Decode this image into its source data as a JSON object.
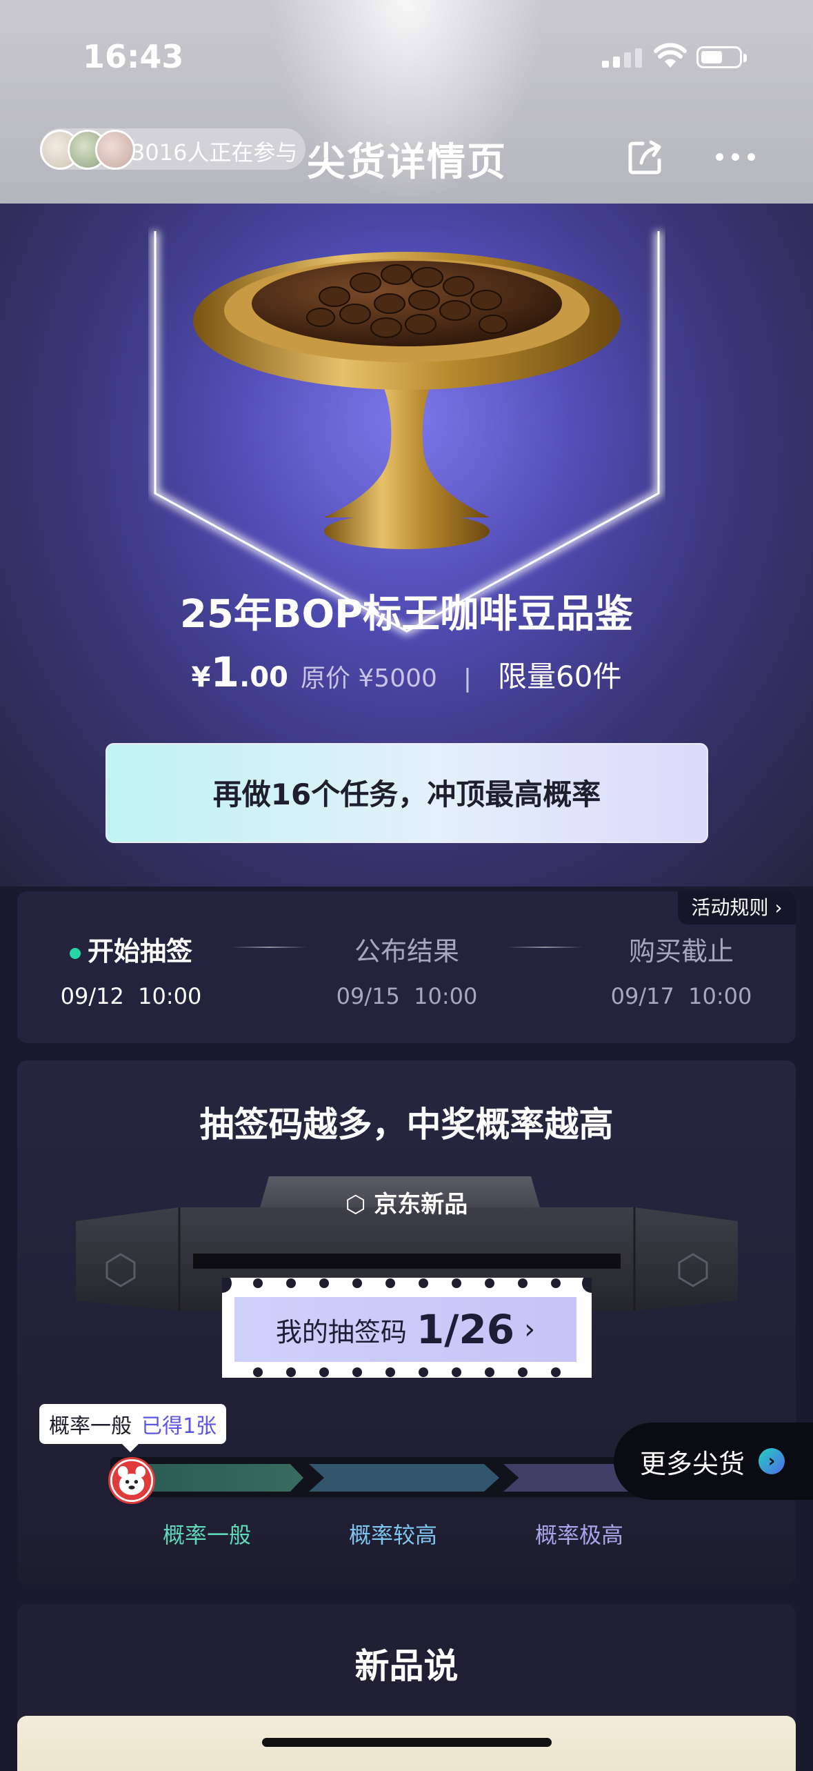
{
  "status_bar": {
    "time": "16:43"
  },
  "header": {
    "participants_text": "3016人正在参与",
    "title": "尖货详情页"
  },
  "product": {
    "title": "25年BOP标王咖啡豆品鉴",
    "price_symbol": "¥",
    "price_int": "1",
    "price_dec": ".00",
    "original_price": "原价 ¥5000",
    "separator": "|",
    "limit": "限量60件"
  },
  "task_button": {
    "label": "再做16个任务，冲顶最高概率"
  },
  "timeline": {
    "rules_label": "活动规则 ›",
    "steps": [
      {
        "label": "开始抽签",
        "time": "09/12  10:00",
        "active": true
      },
      {
        "label": "公布结果",
        "time": "09/15  10:00",
        "active": false
      },
      {
        "label": "购买截止",
        "time": "09/17  10:00",
        "active": false
      }
    ]
  },
  "codes": {
    "title": "抽签码越多，中奖概率越高",
    "brand": "京东新品",
    "my_code_label": "我的抽签码",
    "my_code_value": "1/26",
    "arrow": "›",
    "tip_level": "概率一般",
    "tip_count": "已得1张",
    "segments": [
      "概率一般",
      "概率较高",
      "概率极高"
    ],
    "colors": {
      "seg1_label": "#5fd8b8",
      "seg2_label": "#7ec6ee",
      "seg3_label": "#a8a5ea"
    }
  },
  "floating": {
    "more_label": "更多尖货",
    "arrow": "›"
  },
  "new_section": {
    "title": "新品说"
  }
}
